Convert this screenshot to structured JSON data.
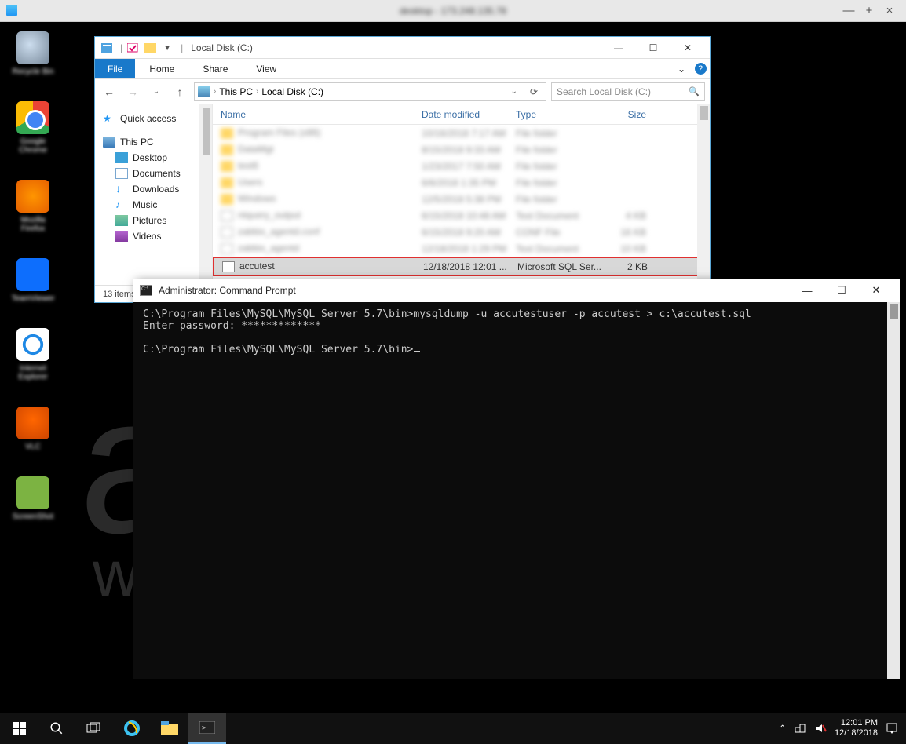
{
  "outer": {
    "title_blur": "desktop - 173.248.135.78",
    "min": "—",
    "max": "+",
    "close": "×"
  },
  "desktop_icons": [
    {
      "name": "recycle-bin",
      "label": "Recycle Bin",
      "cls": "recycle"
    },
    {
      "name": "chrome",
      "label": "Google Chrome",
      "cls": "chrome"
    },
    {
      "name": "firefox",
      "label": "Mozilla Firefox",
      "cls": "ff"
    },
    {
      "name": "teamviewer",
      "label": "TeamViewer",
      "cls": "tv"
    },
    {
      "name": "ie",
      "label": "Internet Explorer",
      "cls": "ie"
    },
    {
      "name": "vlc",
      "label": "VLC",
      "cls": "vlc"
    },
    {
      "name": "green-app",
      "label": "ScreenShot",
      "cls": "green"
    }
  ],
  "watermark": {
    "top": "accu",
    "bottom": "web hosting"
  },
  "explorer": {
    "qat_title": "Local Disk (C:)",
    "win_min": "—",
    "win_max": "☐",
    "win_close": "✕",
    "menu": {
      "file": "File",
      "home": "Home",
      "share": "Share",
      "view": "View",
      "expand": "⌄"
    },
    "nav": {
      "back": "←",
      "fwd": "→",
      "recent": "⌄",
      "up": "↑"
    },
    "crumb": {
      "root": "This PC",
      "leaf": "Local Disk (C:)",
      "chev": "›",
      "drop": "⌄",
      "refresh": "⟳"
    },
    "search_placeholder": "Search Local Disk (C:)",
    "search_icon": "🔍",
    "tree": {
      "quick": "Quick access",
      "thispc": "This PC",
      "desktop": "Desktop",
      "documents": "Documents",
      "downloads": "Downloads",
      "music": "Music",
      "pictures": "Pictures",
      "videos": "Videos"
    },
    "columns": {
      "name": "Name",
      "date": "Date modified",
      "type": "Type",
      "size": "Size"
    },
    "blur_rows": [
      {
        "name": "Program Files (x86)",
        "date": "10/16/2018 7:17 AM",
        "type": "File folder",
        "size": ""
      },
      {
        "name": "DataMgt",
        "date": "8/15/2018 9:33 AM",
        "type": "File folder",
        "size": ""
      },
      {
        "name": "test6",
        "date": "1/23/2017 7:50 AM",
        "type": "File folder",
        "size": ""
      },
      {
        "name": "Users",
        "date": "6/6/2018 1:35 PM",
        "type": "File folder",
        "size": ""
      },
      {
        "name": "Windows",
        "date": "12/5/2018 5:38 PM",
        "type": "File folder",
        "size": ""
      },
      {
        "name": "ntquery_output",
        "date": "6/15/2018 10:48 AM",
        "type": "Text Document",
        "size": "4 KB"
      },
      {
        "name": "zabbix_agentd.conf",
        "date": "6/15/2018 9:20 AM",
        "type": "CONF File",
        "size": "16 KB"
      },
      {
        "name": "zabbix_agentd",
        "date": "12/18/2018 1:29 PM",
        "type": "Text Document",
        "size": "10 KB"
      }
    ],
    "selected": {
      "name": "accutest",
      "date": "12/18/2018 12:01 ...",
      "type": "Microsoft SQL Ser...",
      "size": "2 KB"
    },
    "status": "13 items"
  },
  "cmd": {
    "title": "Administrator: Command Prompt",
    "win_min": "—",
    "win_max": "☐",
    "win_close": "✕",
    "line1": "C:\\Program Files\\MySQL\\MySQL Server 5.7\\bin>mysqldump -u accutestuser -p accutest > c:\\accutest.sql",
    "line2": "Enter password: *************",
    "line3": "",
    "line4": "C:\\Program Files\\MySQL\\MySQL Server 5.7\\bin>"
  },
  "taskbar": {
    "time": "12:01 PM",
    "date": "12/18/2018",
    "tray_up": "⌃"
  }
}
